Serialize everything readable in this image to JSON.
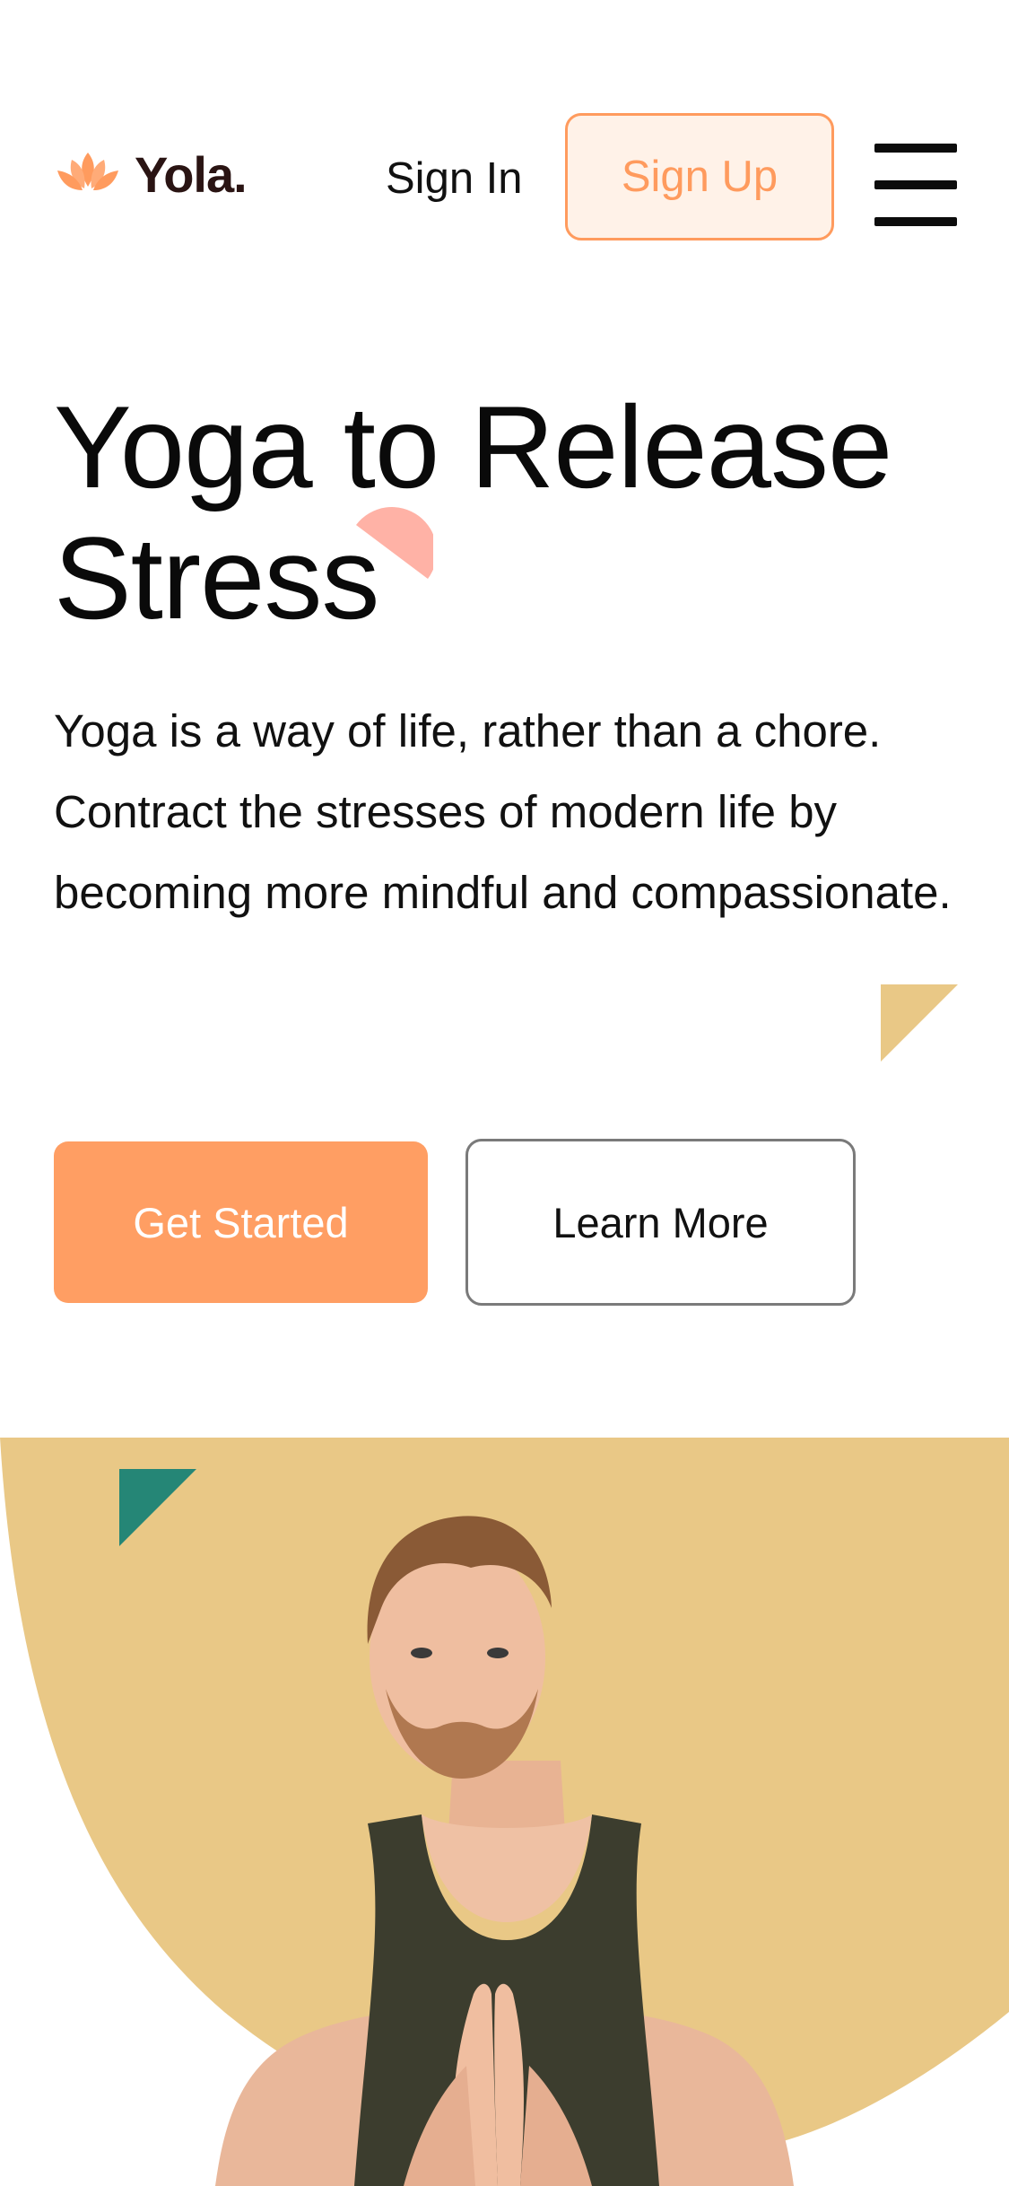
{
  "header": {
    "brand": "Yola.",
    "logo_icon": "lotus-icon",
    "sign_in_label": "Sign In",
    "sign_up_label": "Sign Up",
    "menu_icon": "hamburger-menu-icon"
  },
  "hero": {
    "title": "Yoga to Release Stress",
    "description": "Yoga is a way of life, rather than a chore. Contract the stresses of modern life by becoming more mindful and compassionate.",
    "primary_button": "Get Started",
    "secondary_button": "Learn More",
    "image": "man-in-prayer-pose-photo"
  },
  "colors": {
    "accent": "#ff9e63",
    "accent_light": "#fff2e8",
    "sand": "#e9c886",
    "pink": "#ffb2a6",
    "teal": "#258676",
    "brand_text": "#2a1413"
  }
}
